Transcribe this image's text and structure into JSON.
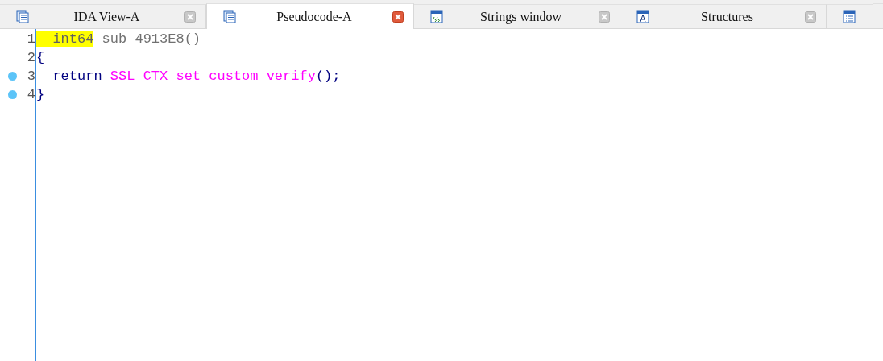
{
  "tabs": [
    {
      "label": "IDA View-A",
      "kind": "listing",
      "selected": false
    },
    {
      "label": "Pseudocode-A",
      "kind": "listing",
      "selected": true
    },
    {
      "label": "Strings window",
      "kind": "strings",
      "selected": false
    },
    {
      "label": "Structures",
      "kind": "structures",
      "selected": false
    },
    {
      "kind": "list",
      "selected": false
    }
  ],
  "code_lines": [
    {
      "number": "1",
      "breakpoint": false,
      "tokens": [
        {
          "text": "__int64",
          "kind": "highlight"
        },
        {
          "text": " sub_4913E8()",
          "kind": "plain"
        }
      ]
    },
    {
      "number": "2",
      "breakpoint": false,
      "tokens": [
        {
          "text": "{",
          "kind": "punct"
        }
      ]
    },
    {
      "number": "3",
      "breakpoint": true,
      "tokens": [
        {
          "text": "  return ",
          "kind": "keyword"
        },
        {
          "text": "SSL_CTX_set_custom_verify",
          "kind": "func"
        },
        {
          "text": "();",
          "kind": "punct"
        }
      ]
    },
    {
      "number": "4",
      "breakpoint": true,
      "tokens": [
        {
          "text": "}",
          "kind": "punct"
        }
      ]
    }
  ]
}
